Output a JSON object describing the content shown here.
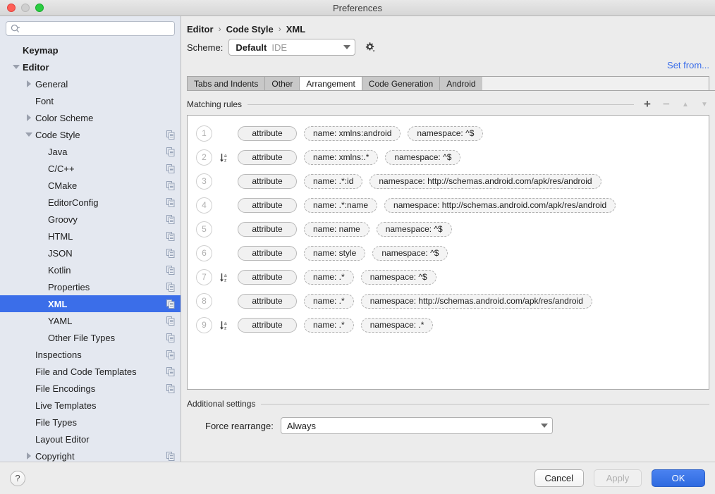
{
  "window": {
    "title": "Preferences",
    "traffic_lights": [
      "close-button",
      "minimize-button",
      "maximize-button"
    ]
  },
  "sidebar": {
    "search": {
      "value": "",
      "placeholder": "",
      "icon": "search-icon"
    },
    "items": [
      {
        "label": "Keymap",
        "indent": 0,
        "bold": true,
        "twisty": "none",
        "copy": false,
        "selected": false
      },
      {
        "label": "Editor",
        "indent": 0,
        "bold": true,
        "twisty": "open",
        "copy": false,
        "selected": false
      },
      {
        "label": "General",
        "indent": 1,
        "bold": false,
        "twisty": "closed",
        "copy": false,
        "selected": false
      },
      {
        "label": "Font",
        "indent": 1,
        "bold": false,
        "twisty": "none",
        "copy": false,
        "selected": false
      },
      {
        "label": "Color Scheme",
        "indent": 1,
        "bold": false,
        "twisty": "closed",
        "copy": false,
        "selected": false
      },
      {
        "label": "Code Style",
        "indent": 1,
        "bold": false,
        "twisty": "open",
        "copy": true,
        "selected": false
      },
      {
        "label": "Java",
        "indent": 2,
        "bold": false,
        "twisty": "none",
        "copy": true,
        "selected": false
      },
      {
        "label": "C/C++",
        "indent": 2,
        "bold": false,
        "twisty": "none",
        "copy": true,
        "selected": false
      },
      {
        "label": "CMake",
        "indent": 2,
        "bold": false,
        "twisty": "none",
        "copy": true,
        "selected": false
      },
      {
        "label": "EditorConfig",
        "indent": 2,
        "bold": false,
        "twisty": "none",
        "copy": true,
        "selected": false
      },
      {
        "label": "Groovy",
        "indent": 2,
        "bold": false,
        "twisty": "none",
        "copy": true,
        "selected": false
      },
      {
        "label": "HTML",
        "indent": 2,
        "bold": false,
        "twisty": "none",
        "copy": true,
        "selected": false
      },
      {
        "label": "JSON",
        "indent": 2,
        "bold": false,
        "twisty": "none",
        "copy": true,
        "selected": false
      },
      {
        "label": "Kotlin",
        "indent": 2,
        "bold": false,
        "twisty": "none",
        "copy": true,
        "selected": false
      },
      {
        "label": "Properties",
        "indent": 2,
        "bold": false,
        "twisty": "none",
        "copy": true,
        "selected": false
      },
      {
        "label": "XML",
        "indent": 2,
        "bold": false,
        "twisty": "none",
        "copy": true,
        "selected": true
      },
      {
        "label": "YAML",
        "indent": 2,
        "bold": false,
        "twisty": "none",
        "copy": true,
        "selected": false
      },
      {
        "label": "Other File Types",
        "indent": 2,
        "bold": false,
        "twisty": "none",
        "copy": true,
        "selected": false
      },
      {
        "label": "Inspections",
        "indent": 1,
        "bold": false,
        "twisty": "none",
        "copy": true,
        "selected": false
      },
      {
        "label": "File and Code Templates",
        "indent": 1,
        "bold": false,
        "twisty": "none",
        "copy": true,
        "selected": false
      },
      {
        "label": "File Encodings",
        "indent": 1,
        "bold": false,
        "twisty": "none",
        "copy": true,
        "selected": false
      },
      {
        "label": "Live Templates",
        "indent": 1,
        "bold": false,
        "twisty": "none",
        "copy": false,
        "selected": false
      },
      {
        "label": "File Types",
        "indent": 1,
        "bold": false,
        "twisty": "none",
        "copy": false,
        "selected": false
      },
      {
        "label": "Layout Editor",
        "indent": 1,
        "bold": false,
        "twisty": "none",
        "copy": false,
        "selected": false
      },
      {
        "label": "Copyright",
        "indent": 1,
        "bold": false,
        "twisty": "closed",
        "copy": true,
        "selected": false
      }
    ]
  },
  "main": {
    "breadcrumb": [
      "Editor",
      "Code Style",
      "XML"
    ],
    "breadcrumb_separator": "›",
    "scheme": {
      "label": "Scheme:",
      "value": "Default",
      "sub_value": "IDE",
      "gear_icon": "gear-icon"
    },
    "set_from_link": "Set from...",
    "tabs": [
      {
        "label": "Tabs and Indents",
        "active": false
      },
      {
        "label": "Other",
        "active": false
      },
      {
        "label": "Arrangement",
        "active": true
      },
      {
        "label": "Code Generation",
        "active": false
      },
      {
        "label": "Android",
        "active": false
      }
    ],
    "matching_rules": {
      "title": "Matching rules",
      "toolbar": [
        {
          "name": "add-rule-button",
          "glyph": "+",
          "enabled": true
        },
        {
          "name": "remove-rule-button",
          "glyph": "−",
          "enabled": false
        },
        {
          "name": "move-rule-up-button",
          "glyph": "▲",
          "enabled": false
        },
        {
          "name": "move-rule-down-button",
          "glyph": "▼",
          "enabled": false
        }
      ],
      "rows": [
        {
          "num": "1",
          "sort": false,
          "type": "attribute",
          "conditions": [
            "name: xmlns:android",
            "namespace: ^$"
          ]
        },
        {
          "num": "2",
          "sort": true,
          "type": "attribute",
          "conditions": [
            "name: xmlns:.*",
            "namespace: ^$"
          ]
        },
        {
          "num": "3",
          "sort": false,
          "type": "attribute",
          "conditions": [
            "name: .*:id",
            "namespace: http://schemas.android.com/apk/res/android"
          ]
        },
        {
          "num": "4",
          "sort": false,
          "type": "attribute",
          "conditions": [
            "name: .*:name",
            "namespace: http://schemas.android.com/apk/res/android"
          ]
        },
        {
          "num": "5",
          "sort": false,
          "type": "attribute",
          "conditions": [
            "name: name",
            "namespace: ^$"
          ]
        },
        {
          "num": "6",
          "sort": false,
          "type": "attribute",
          "conditions": [
            "name: style",
            "namespace: ^$"
          ]
        },
        {
          "num": "7",
          "sort": true,
          "type": "attribute",
          "conditions": [
            "name: .*",
            "namespace: ^$"
          ]
        },
        {
          "num": "8",
          "sort": false,
          "type": "attribute",
          "conditions": [
            "name: .*",
            "namespace: http://schemas.android.com/apk/res/android"
          ]
        },
        {
          "num": "9",
          "sort": true,
          "type": "attribute",
          "conditions": [
            "name: .*",
            "namespace: .*"
          ]
        }
      ]
    },
    "additional_settings": {
      "title": "Additional settings",
      "force_rearrange_label": "Force rearrange:",
      "force_rearrange_value": "Always"
    }
  },
  "footer": {
    "help_glyph": "?",
    "cancel_label": "Cancel",
    "apply_label": "Apply",
    "ok_label": "OK"
  },
  "colors": {
    "accent": "#3b6ee9",
    "selection": "#3b6ee9",
    "primary_button": "#2f6ae0",
    "window_bg": "#ececec",
    "sidebar_bg": "#e4e8f0"
  }
}
